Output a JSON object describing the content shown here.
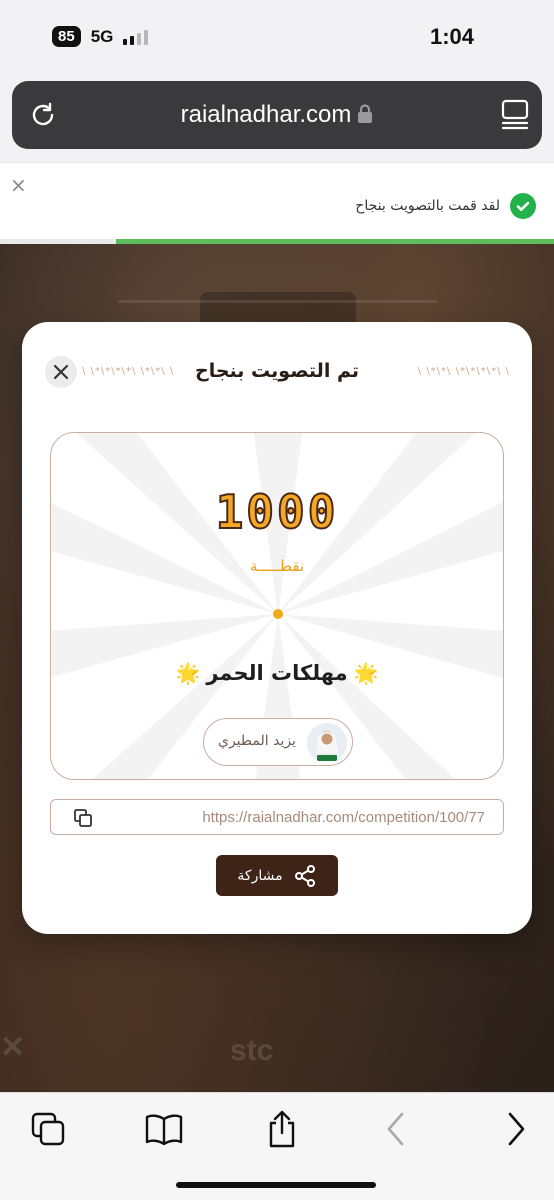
{
  "status_bar": {
    "battery": "85",
    "network": "5G",
    "time": "1:04"
  },
  "browser": {
    "url": "raialnadhar.com"
  },
  "toast": {
    "close": "×",
    "message": "لقد قمت بالتصويت بنجاح",
    "progress_fraction": 0.21
  },
  "modal": {
    "title": "تم التصويت بنجاح",
    "deco_left": "\\ \\*\\*\\*\\*\\ \\*\\*\\ \\",
    "deco_right": "\\ \\*\\*\\ \\*\\*\\*\\*\\ \\",
    "points": "1000",
    "points_label": "نقطـــــة",
    "nominee": "مهلكات الحمر",
    "voter_name": "يزيد المطيري",
    "share_link": "https://raialnadhar.com/competition/100/77",
    "share_label": "مشاركة"
  },
  "colors": {
    "accent_gold": "#f4a825",
    "brand_brown": "#3d2416",
    "success_green": "#21b24a"
  },
  "icons": {
    "toolbar": [
      "tabs-icon",
      "bookmarks-icon",
      "share-icon",
      "back-icon",
      "forward-icon"
    ]
  }
}
